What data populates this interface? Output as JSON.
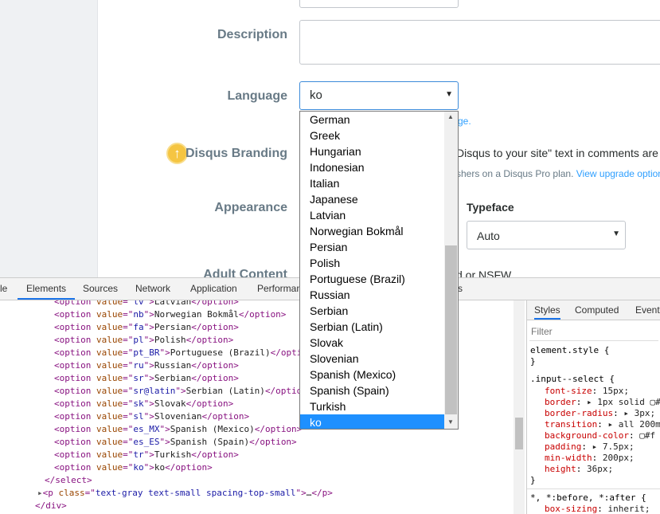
{
  "form": {
    "description_label": "Description",
    "language_label": "Language",
    "branding_label": "Disqus Branding",
    "appearance_label": "Appearance",
    "adult_label": "Adult Content",
    "language_help_suffix": "ge.",
    "branding_text": "Disqus to your site\" text in comments are",
    "branding_subtext": "shers on a Disqus Pro plan.",
    "branding_link": "View upgrade option",
    "typeface_label": "Typeface",
    "typeface_value": "Auto",
    "adult_text": "d or NSFW"
  },
  "language_select": {
    "value": "ko",
    "options": [
      "German",
      "Greek",
      "Hungarian",
      "Indonesian",
      "Italian",
      "Japanese",
      "Latvian",
      "Norwegian Bokmål",
      "Persian",
      "Polish",
      "Portuguese (Brazil)",
      "Russian",
      "Serbian",
      "Serbian (Latin)",
      "Slovak",
      "Slovenian",
      "Spanish (Mexico)",
      "Spanish (Spain)",
      "Turkish",
      "ko"
    ],
    "selected": "ko"
  },
  "devtools": {
    "tabs": [
      "le",
      "Elements",
      "Sources",
      "Network",
      "Application",
      "Performan",
      "s"
    ],
    "active_tab": "Elements",
    "code_lines": [
      {
        "indent": 4,
        "value": "lv",
        "text": "Latvian"
      },
      {
        "indent": 4,
        "value": "nb",
        "text": "Norwegian Bokmål"
      },
      {
        "indent": 4,
        "value": "fa",
        "text": "Persian"
      },
      {
        "indent": 4,
        "value": "pl",
        "text": "Polish"
      },
      {
        "indent": 4,
        "value": "pt_BR",
        "text": "Portuguese (Brazil)"
      },
      {
        "indent": 4,
        "value": "ru",
        "text": "Russian"
      },
      {
        "indent": 4,
        "value": "sr",
        "text": "Serbian"
      },
      {
        "indent": 4,
        "value": "sr@latin",
        "text": "Serbian (Latin)"
      },
      {
        "indent": 4,
        "value": "sk",
        "text": "Slovak"
      },
      {
        "indent": 4,
        "value": "sl",
        "text": "Slovenian"
      },
      {
        "indent": 4,
        "value": "es_MX",
        "text": "Spanish (Mexico)"
      },
      {
        "indent": 4,
        "value": "es_ES",
        "text": "Spanish (Spain)"
      },
      {
        "indent": 4,
        "value": "tr",
        "text": "Turkish"
      },
      {
        "indent": 4,
        "value": "ko",
        "text": "ko"
      }
    ],
    "close_select": "</select>",
    "p_line_class": "text-gray text-small spacing-top-small",
    "close_div": "</div>",
    "styles_tabs": [
      "Styles",
      "Computed",
      "Event"
    ],
    "filter_placeholder": "Filter",
    "element_style": "element.style {",
    "close_brace": "}",
    "rule_selector": ".input--select {",
    "rule_props": [
      {
        "name": "font-size",
        "value": "15px;"
      },
      {
        "name": "border",
        "value": "▸ 1px solid ▢#"
      },
      {
        "name": "border-radius",
        "value": "▸ 3px;"
      },
      {
        "name": "transition",
        "value": "▸ all 200ms"
      },
      {
        "name": "background-color",
        "value": "▢#f"
      },
      {
        "name": "padding",
        "value": "▸ 7.5px;"
      },
      {
        "name": "min-width",
        "value": "200px;"
      },
      {
        "name": "height",
        "value": "36px;"
      }
    ],
    "universal_selector": "*, *:before, *:after {",
    "universal_prop": {
      "name": "box-sizing",
      "value": "inherit;"
    }
  },
  "colors": {
    "accent": "#1e90ff",
    "label": "#687a86",
    "link": "#2e9fff"
  }
}
